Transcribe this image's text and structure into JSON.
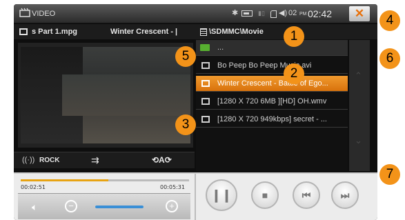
{
  "header": {
    "app_title": "VIDEO",
    "volume_level": "02",
    "clock_ampm": "PM",
    "clock_time": "02:42",
    "close_label": "✕"
  },
  "now_playing": {
    "file": "s Part 1.mpg",
    "title": "Winter Crescent - |"
  },
  "browser": {
    "path": "\\SDMMC\\Movie",
    "up_label": "...",
    "files": [
      "Bo Peep Bo Peep Music.avi",
      "Winter Crescent - Battle of Ego...",
      "[1280 X 720 6MB ][HD] OH.wmv",
      "[1280 X 720 949kbps] secret - ..."
    ],
    "selected_index": 1
  },
  "effects": {
    "eq_label": "ROCK"
  },
  "playback": {
    "elapsed": "00:02:51",
    "total": "00:05:31",
    "progress_percent": 52,
    "volume_percent": 100
  },
  "callouts": [
    "1",
    "2",
    "3",
    "4",
    "5",
    "6",
    "7"
  ],
  "colors": {
    "accent": "#f39319",
    "selected_row": "#e8830f",
    "close_x": "#e8700a",
    "progress": "#e7a312",
    "volume": "#3a8fd6"
  }
}
